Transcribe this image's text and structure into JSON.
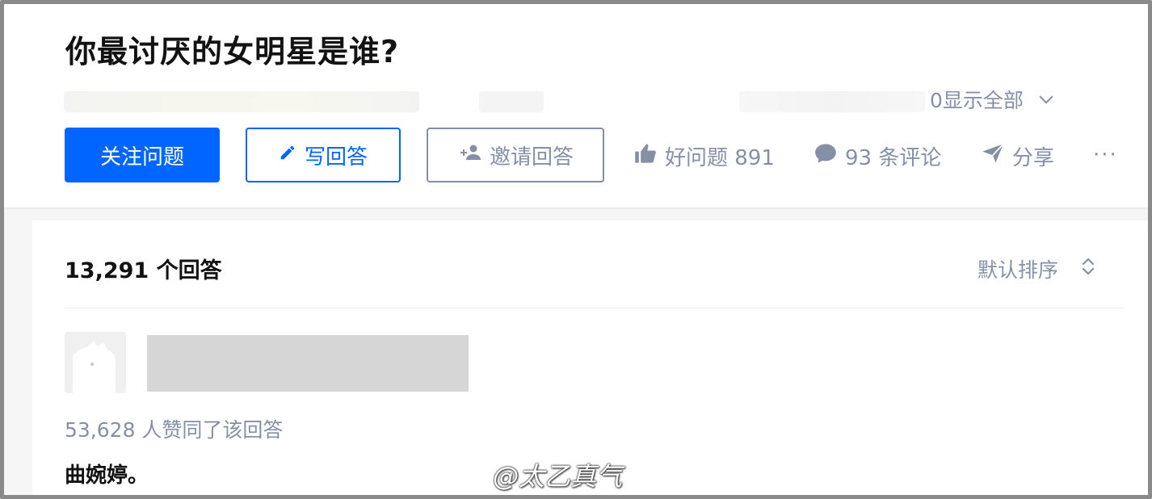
{
  "question": {
    "title": "你最讨厌的女明星是谁?",
    "show_all": "0显示全部"
  },
  "actions": {
    "follow": "关注问题",
    "write": "写回答",
    "invite": "邀请回答",
    "like": "好问题 891",
    "comments": "93 条评论",
    "share": "分享",
    "more": "···"
  },
  "answers": {
    "count": "13,291 个回答",
    "sort": "默认排序",
    "first": {
      "voters": "53,628 人赞同了该回答",
      "text": "曲婉婷。"
    }
  },
  "watermark": "@太乙真气",
  "colors": {
    "primary": "#0066ff",
    "muted": "#8590a6",
    "text": "#121212"
  },
  "icons": [
    "pencil-icon",
    "add-person-icon",
    "thumb-up-icon",
    "comment-icon",
    "share-icon",
    "more-icon",
    "chevron-down-icon",
    "sort-icon"
  ]
}
